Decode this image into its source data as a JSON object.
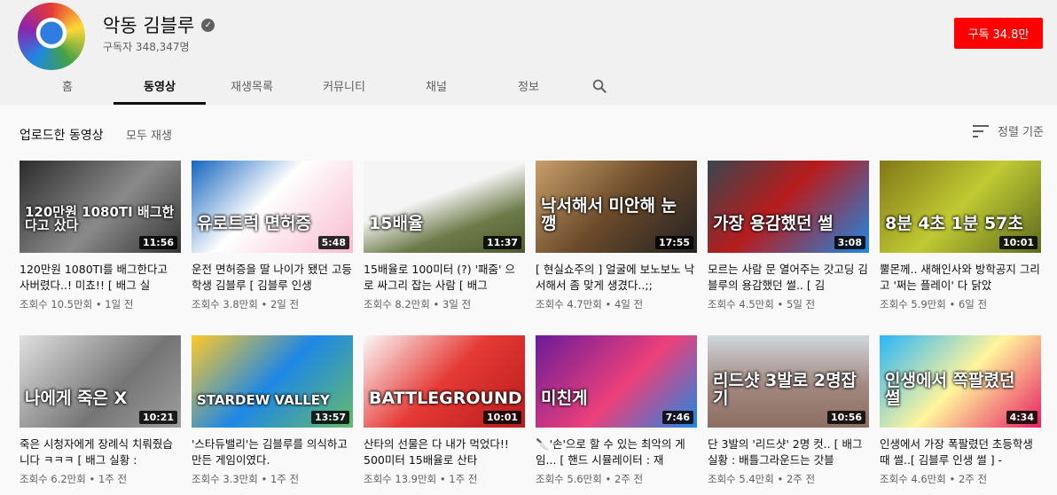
{
  "channel": {
    "name": "악동 김블루",
    "subscribers": "구독자 348,347명",
    "subscribe_label": "구독",
    "subscribe_count": "34.8만"
  },
  "tabs": [
    {
      "label": "홈"
    },
    {
      "label": "동영상"
    },
    {
      "label": "재생목록"
    },
    {
      "label": "커뮤니티"
    },
    {
      "label": "채널"
    },
    {
      "label": "정보"
    }
  ],
  "toolbar": {
    "title": "업로드한 동영상",
    "play_all": "모두 재생",
    "sort_label": "정렬 기준"
  },
  "colors": {
    "accent": "#ff0000"
  },
  "videos": [
    {
      "title": "120만원 1080TI를 배그한다고 사버렸다..! 미쵸!! [ 배그 실",
      "views": "조회수 10.5만회",
      "age": "1일 전",
      "duration": "11:56",
      "overlay": "120만원 1080TI 배그한다고 샀다",
      "bg": "linear-gradient(135deg,#2c2c2c,#8a8a8a 55%,#333)"
    },
    {
      "title": "운전 면허증을 딸 나이가 됐던 고등학생 김블루 [ 김블루 인생",
      "views": "조회수 3.8만회",
      "age": "2일 전",
      "duration": "5:48",
      "overlay": "유로트럭 면허증",
      "bg": "linear-gradient(135deg,#1565c0,#ffffff 45%,#f8bbd0)"
    },
    {
      "title": "15배율로 100미터 (?) '패줌' 으로 싸그리 잡는 사람 [ 배그",
      "views": "조회수 8.2만회",
      "age": "3일 전",
      "duration": "11:37",
      "overlay": "15배율",
      "bg": "linear-gradient(160deg,#f5f5f5 40%,#6d7b4a 70%,#4e5a30)"
    },
    {
      "title": "[ 현실쇼주의 ] 얼굴에 보노보노 낙서해서 좀 맞게 생겼다..;;",
      "views": "조회수 4.7만회",
      "age": "4일 전",
      "duration": "17:55",
      "overlay": "낙서해서 미안해 눈깽",
      "bg": "linear-gradient(135deg,#c8a06a,#6b4a2a 50%,#222)"
    },
    {
      "title": "모르는 사람 문 열어주는 갓고딩 김블루의 용감했던 썰.. [ 김",
      "views": "조회수 4.5만회",
      "age": "5일 전",
      "duration": "3:08",
      "overlay": "가장 용감했던 썰",
      "bg": "linear-gradient(135deg,#37474f,#b71c1c 45%,#1e88e5)"
    },
    {
      "title": "뿔몬께.. 새해인사와 방학공지 그리고 '쩌는 플레이' 다 닭았",
      "views": "조회수 5.9만회",
      "age": "6일 전",
      "duration": "10:01",
      "overlay": "8분 4초 1분 57초",
      "bg": "linear-gradient(135deg,#827717,#c0ca33 50%,#5d6a1e)"
    },
    {
      "title": "죽은 시청자에게 장례식 치뤄줬습니다 ㅋㅋㅋ [ 배그 실황 :",
      "views": "조회수 6.2만회",
      "age": "1주 전",
      "duration": "10:21",
      "overlay": "나에게 죽은 X",
      "bg": "linear-gradient(135deg,#e0e0e0,#757575 60%,#9e9e9e)"
    },
    {
      "title": "'스타듀밸리'는 김블루를 의식하고 만든 게임이였다.",
      "views": "조회수 3.3만회",
      "age": "1주 전",
      "duration": "13:57",
      "overlay": "STARDEW VALLEY",
      "bg": "linear-gradient(135deg,#ffca28,#1e88e5 50%,#66bb6a)"
    },
    {
      "title": "산타의 선물은 다 내가 먹었다!! 500미터 15배율로 산타",
      "views": "조회수 13.9만회",
      "age": "1주 전",
      "duration": "10:01",
      "overlay": "BATTLEGROUND",
      "bg": "linear-gradient(135deg,#fafafa,#e53935 50%,#b71c1c)"
    },
    {
      "title": "🔪'손'으로 할 수 있는 최악의 게임... [ 핸드 시뮬레이터 : 재",
      "views": "조회수 5.6만회",
      "age": "2주 전",
      "duration": "7:46",
      "overlay": "미친게",
      "bg": "linear-gradient(135deg,#6a1b9a,#ec407a 55%,#1e88e5)"
    },
    {
      "title": "단 3발의 '리드샷' 2명 컷.. [ 배그 실황 : 배틀그라운드는 갓블",
      "views": "조회수 5.4만회",
      "age": "2주 전",
      "duration": "10:56",
      "overlay": "리드샷 3발로 2명잡기",
      "bg": "linear-gradient(180deg,#cfd8dc,#a1887f 55%,#8d6e63)"
    },
    {
      "title": "인생에서 가장 폭팔렸던 초등학생때 썰..[ 김블루 인생 썰 ] -",
      "views": "조회수 4.6만회",
      "age": "2주 전",
      "duration": "4:34",
      "overlay": "인생에서 쪽팔렸던 썰",
      "bg": "linear-gradient(135deg,#29b6f6,#fff59d 50%,#e91e63)"
    }
  ]
}
